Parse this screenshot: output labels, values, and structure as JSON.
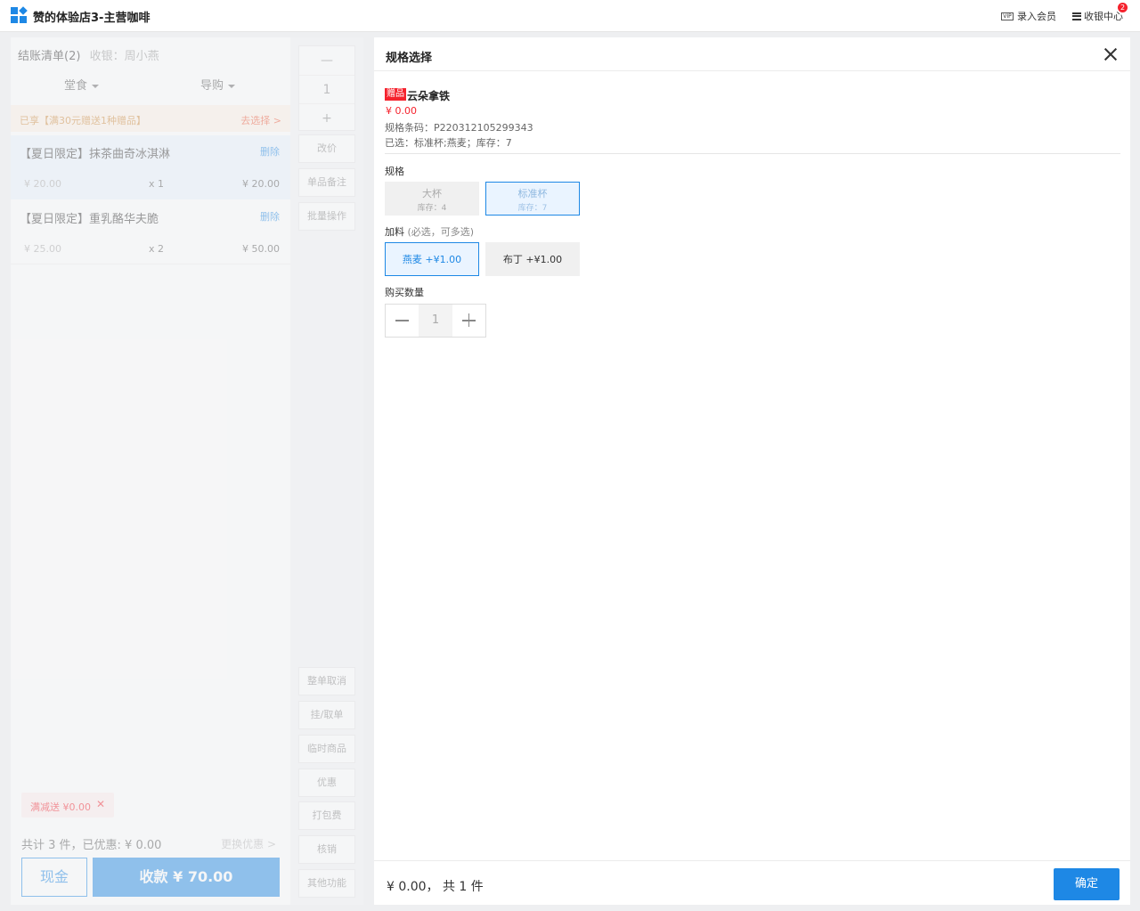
{
  "header": {
    "store_title": "赞的体验店3-主营咖啡",
    "vip_icon_text": "VIP",
    "vip_link": "录入会员",
    "cash_center": "收银中心",
    "badge_count": "2"
  },
  "cart": {
    "title": "结账清单(2)",
    "cashier": "收银：周小燕",
    "mode_dine": "堂食",
    "mode_guide": "导购",
    "promo_text": "已享【满30元赠送1种赠品】",
    "promo_link": "去选择 >",
    "items": [
      {
        "name": "【夏日限定】抹茶曲奇冰淇淋",
        "delete": "删除",
        "price": "¥ 20.00",
        "qty": "x 1",
        "subtotal": "¥ 20.00"
      },
      {
        "name": "【夏日限定】重乳酪华夫脆",
        "delete": "删除",
        "price": "¥ 25.00",
        "qty": "x 2",
        "subtotal": "¥ 50.00"
      }
    ],
    "discount_tag": "满减送 ¥0.00",
    "discount_close": "✕",
    "summary": "共计 3 件，已优惠: ¥ 0.00",
    "change_discount": "更换优惠  >",
    "cash_button": "现金",
    "pay_button": "收款 ¥ 70.00"
  },
  "actions": {
    "stepper_minus": "—",
    "stepper_value": "1",
    "stepper_plus": "+",
    "top": [
      "改价",
      "单品备注",
      "批量操作"
    ],
    "bottom": [
      "整单取消",
      "挂/取单",
      "临时商品",
      "优惠",
      "打包费",
      "核销",
      "其他功能"
    ]
  },
  "modal": {
    "title": "规格选择",
    "product": {
      "tag": "赠品",
      "name": "云朵拿铁",
      "price": "¥  0.00",
      "code": "规格条码：P220312105299343",
      "selected": "已选：标准杯;燕麦；库存：7"
    },
    "spec_label": "规格",
    "specs": [
      {
        "label": "大杯",
        "stock": "库存：4"
      },
      {
        "label": "标准杯",
        "stock": "库存：7"
      }
    ],
    "addon_label": "加料",
    "addon_hint": "(必选，可多选)",
    "addons": [
      {
        "label": "燕麦 +¥1.00"
      },
      {
        "label": "布丁 +¥1.00"
      }
    ],
    "qty_label": "购买数量",
    "qty_value": "1",
    "footer_total": "¥ 0.00，  共 1 件",
    "confirm": "确定"
  },
  "colors": {
    "accent": "#1e88e5",
    "danger": "#f5222d",
    "promo_bg": "#fff3e6"
  }
}
